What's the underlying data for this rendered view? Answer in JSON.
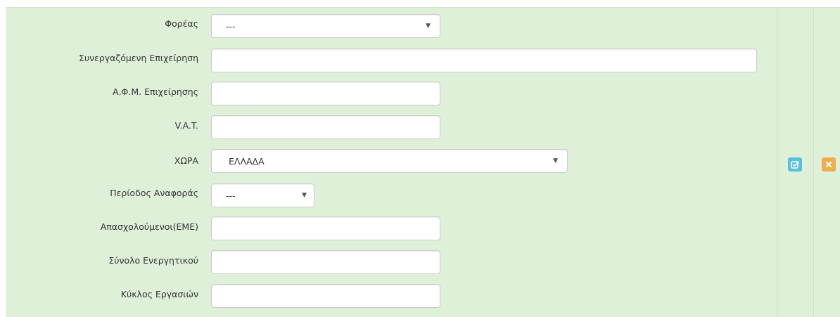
{
  "form": {
    "fields": [
      {
        "label": "Φορέας",
        "type": "select",
        "value": "---"
      },
      {
        "label": "Συνεργαζόμενη Επιχείρηση",
        "type": "text",
        "value": ""
      },
      {
        "label": "Α.Φ.Μ. Επιχείρησης",
        "type": "text",
        "value": ""
      },
      {
        "label": "V.A.T.",
        "type": "text",
        "value": ""
      },
      {
        "label": "ΧΩΡΑ",
        "type": "select",
        "value": "ΕΛΛΑΔΑ"
      },
      {
        "label": "Περίοδος Αναφοράς",
        "type": "select",
        "value": "---"
      },
      {
        "label": "Απασχολούμενοι(ΕΜΕ)",
        "type": "text",
        "value": ""
      },
      {
        "label": "Σύνολο Ενεργητικού",
        "type": "text",
        "value": ""
      },
      {
        "label": "Κύκλος Εργασιών",
        "type": "text",
        "value": ""
      }
    ]
  },
  "actions": {
    "edit": {
      "icon": "edit-check-icon",
      "color": "#5bc0de"
    },
    "cancel": {
      "icon": "close-icon",
      "color": "#f0ad4e"
    }
  },
  "colors": {
    "row_background": "#dff0d8",
    "input_border": "#cccccc"
  }
}
